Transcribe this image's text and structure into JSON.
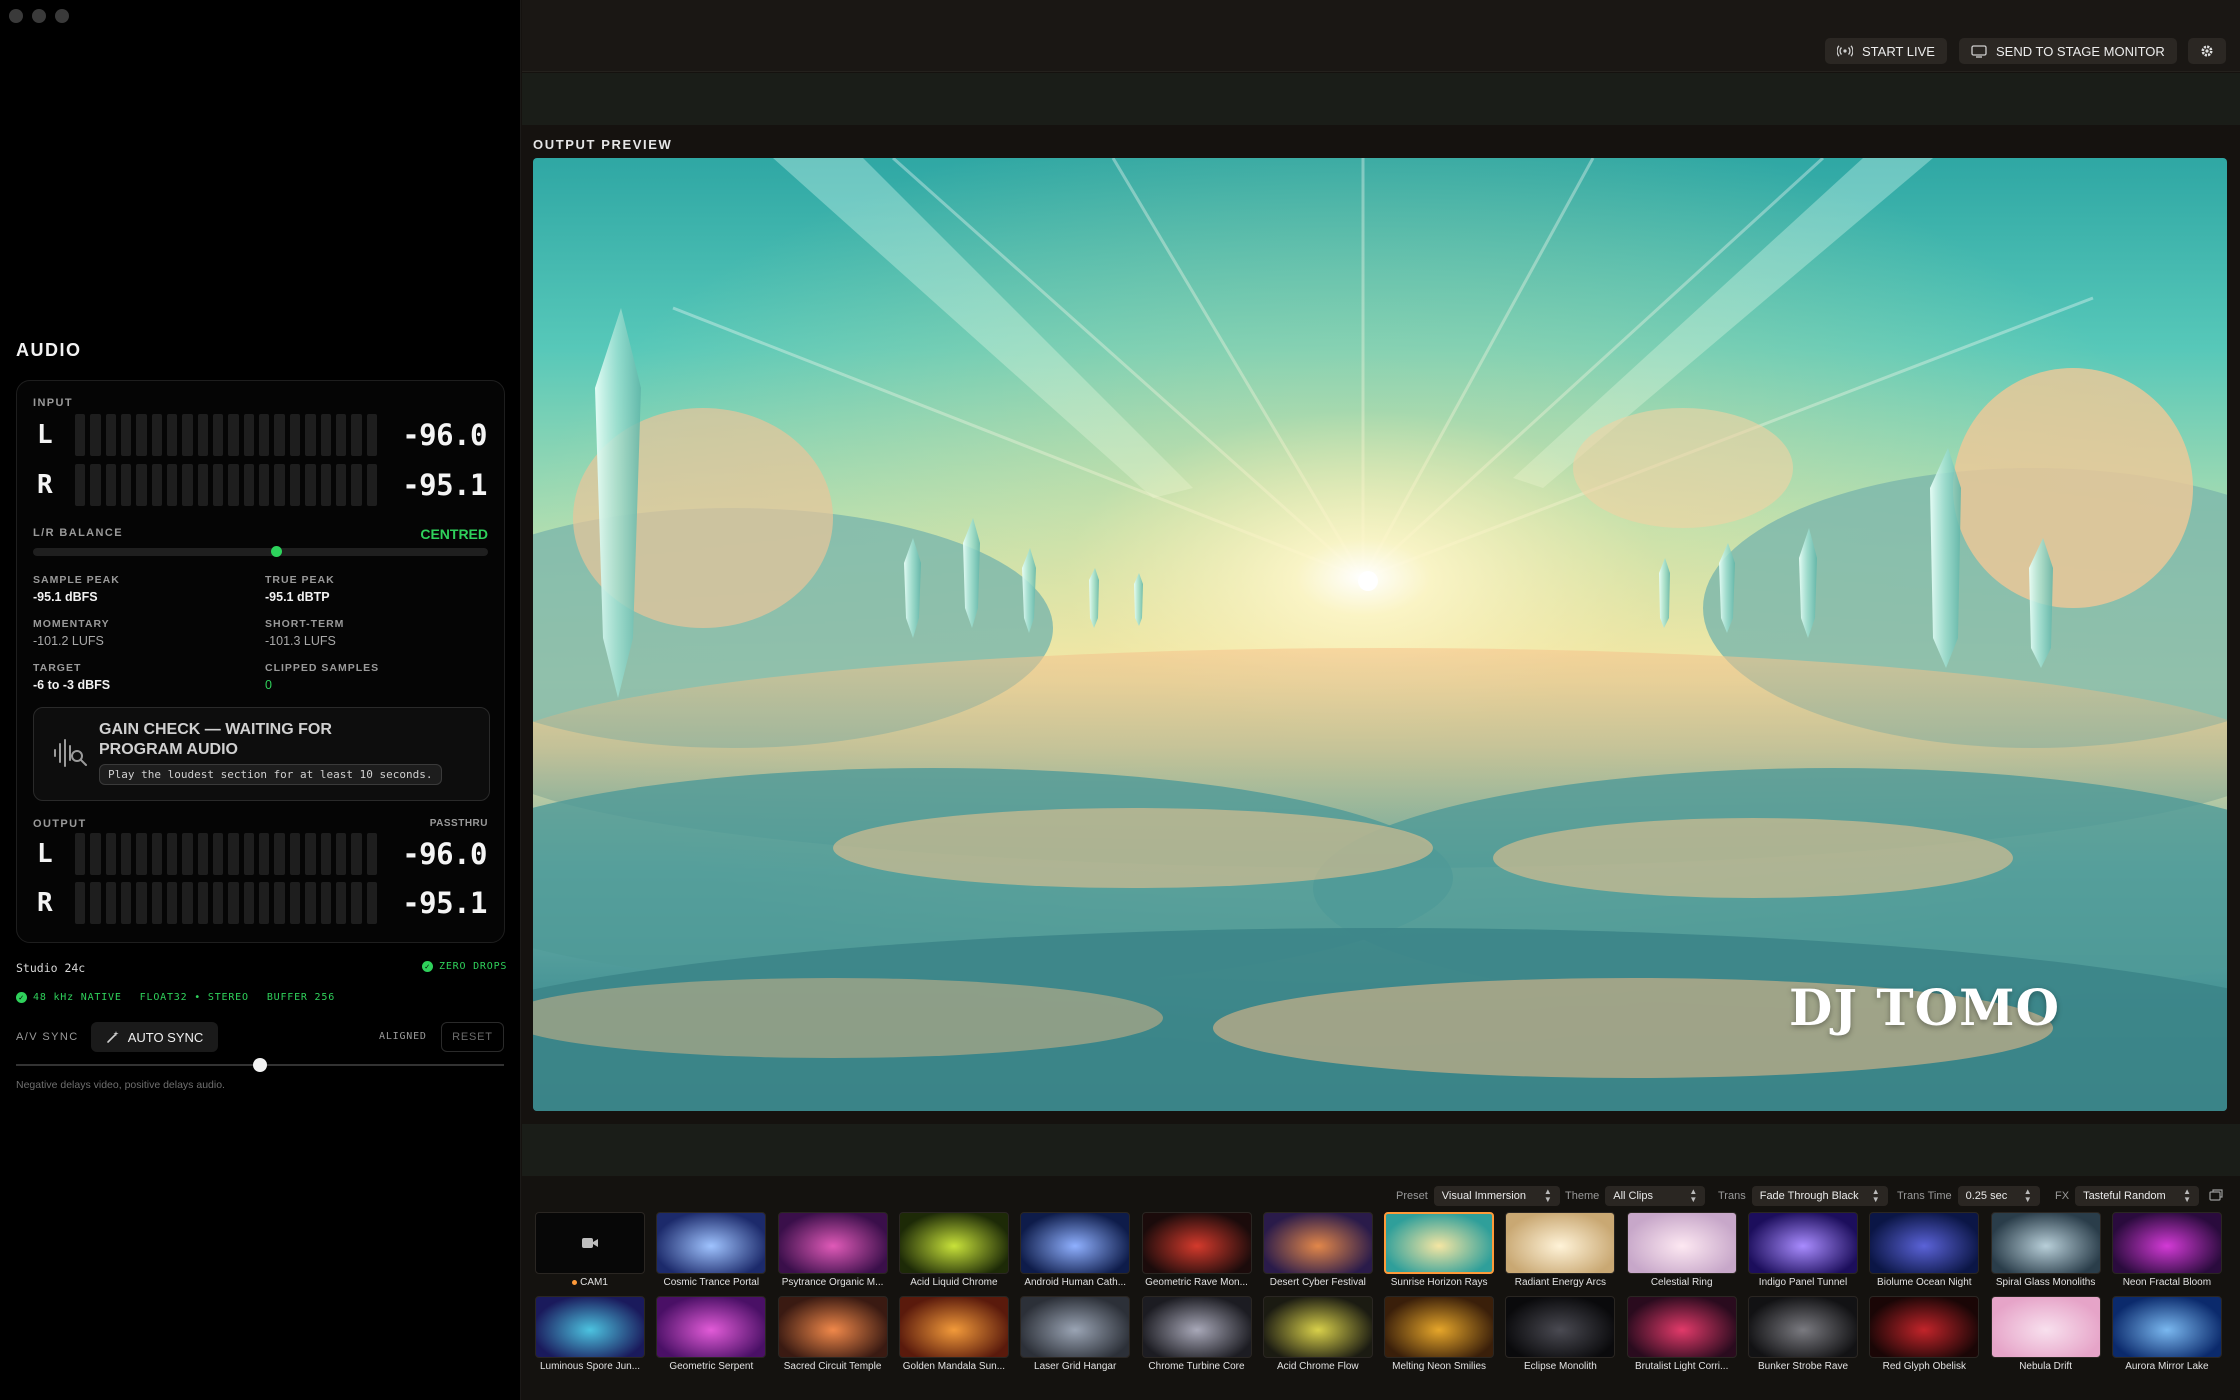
{
  "sidebar": {
    "title": "AUDIO",
    "input": {
      "label": "INPUT",
      "left": {
        "ch": "L",
        "value": "-96.0"
      },
      "right": {
        "ch": "R",
        "value": "-95.1"
      }
    },
    "balance": {
      "label": "L/R BALANCE",
      "status": "CENTRED",
      "position": 0.5
    },
    "stats": {
      "sample_peak": {
        "k": "SAMPLE PEAK",
        "v": "-95.1 dBFS"
      },
      "true_peak": {
        "k": "TRUE PEAK",
        "v": "-95.1 dBTP"
      },
      "momentary": {
        "k": "MOMENTARY",
        "v": "-101.2 LUFS"
      },
      "short_term": {
        "k": "SHORT-TERM",
        "v": "-101.3 LUFS"
      },
      "target": {
        "k": "TARGET",
        "v": "-6 to -3 dBFS"
      },
      "clipped": {
        "k": "CLIPPED SAMPLES",
        "v": "0"
      }
    },
    "gain_check": {
      "title": "GAIN CHECK — WAITING FOR PROGRAM AUDIO",
      "hint": "Play the loudest section for at least 10 seconds."
    },
    "output": {
      "label": "OUTPUT",
      "mode": "PASSTHRU",
      "left": {
        "ch": "L",
        "value": "-96.0"
      },
      "right": {
        "ch": "R",
        "value": "-95.1"
      }
    },
    "device": {
      "name": "Studio 24c",
      "drops": "ZERO DROPS",
      "rate": "48 kHz NATIVE",
      "format": "FLOAT32 • STEREO",
      "buffer": "BUFFER 256"
    },
    "av_sync": {
      "label": "A/V SYNC",
      "auto": "AUTO SYNC",
      "status": "ALIGNED",
      "reset": "RESET",
      "hint": "Negative delays video, positive delays audio.",
      "slider": 0.5
    }
  },
  "toolbar": {
    "start_live": "START LIVE",
    "stage_monitor": "SEND TO STAGE MONITOR"
  },
  "preview": {
    "label": "OUTPUT PREVIEW",
    "overlay_text": "DJ TOMO"
  },
  "controls": {
    "preset": {
      "label": "Preset",
      "value": "Visual Immersion"
    },
    "theme": {
      "label": "Theme",
      "value": "All Clips"
    },
    "trans": {
      "label": "Trans",
      "value": "Fade Through Black"
    },
    "trans_time": {
      "label": "Trans Time",
      "value": "0.25 sec"
    },
    "fx": {
      "label": "FX",
      "value": "Tasteful Random"
    }
  },
  "clips_row1": [
    {
      "name": "CAM1",
      "cam": true
    },
    {
      "name": "Cosmic Trance Portal",
      "c1": "#1c2a6b",
      "c2": "#9fc3ff"
    },
    {
      "name": "Psytrance Organic M...",
      "c1": "#3a0f4a",
      "c2": "#e05ab8"
    },
    {
      "name": "Acid Liquid Chrome",
      "c1": "#1d2a07",
      "c2": "#c8e23a"
    },
    {
      "name": "Android Human Cath...",
      "c1": "#0e1c4a",
      "c2": "#8fb0ff"
    },
    {
      "name": "Geometric Rave Mon...",
      "c1": "#1b0b0b",
      "c2": "#d43a2c"
    },
    {
      "name": "Desert Cyber Festival",
      "c1": "#2a1b4a",
      "c2": "#e2874a"
    },
    {
      "name": "Sunrise Horizon Rays",
      "c1": "#2f9f9a",
      "c2": "#f5e6a3",
      "active": true
    },
    {
      "name": "Radiant Energy Arcs",
      "c1": "#c9a873",
      "c2": "#fff3d8"
    },
    {
      "name": "Celestial Ring",
      "c1": "#c7a7c9",
      "c2": "#fde8f2"
    },
    {
      "name": "Indigo Panel Tunnel",
      "c1": "#1c0e5c",
      "c2": "#a98cff"
    },
    {
      "name": "Biolume Ocean Night",
      "c1": "#0b1646",
      "c2": "#5b63d8"
    },
    {
      "name": "Spiral Glass Monoliths",
      "c1": "#2a3d4a",
      "c2": "#b8cfd9"
    },
    {
      "name": "Neon Fractal Bloom",
      "c1": "#2a0b3d",
      "c2": "#d33ad6"
    }
  ],
  "clips_row2": [
    {
      "name": "Luminous Spore Jun...",
      "c1": "#1a1a5c",
      "c2": "#4cc3e0"
    },
    {
      "name": "Geometric Serpent",
      "c1": "#4a1066",
      "c2": "#e25bd8"
    },
    {
      "name": "Sacred Circuit Temple",
      "c1": "#3a1a12",
      "c2": "#f0884a"
    },
    {
      "name": "Golden Mandala Sun...",
      "c1": "#5a1a0c",
      "c2": "#f29a3a"
    },
    {
      "name": "Laser Grid Hangar",
      "c1": "#2c3038",
      "c2": "#9aa4b4"
    },
    {
      "name": "Chrome Turbine Core",
      "c1": "#1c1c22",
      "c2": "#a8a8b8"
    },
    {
      "name": "Acid Chrome Flow",
      "c1": "#1b1b12",
      "c2": "#d8d04a"
    },
    {
      "name": "Melting Neon Smilies",
      "c1": "#3a1f0a",
      "c2": "#e6a62a"
    },
    {
      "name": "Eclipse Monolith",
      "c1": "#0a0a0c",
      "c2": "#4a4a52"
    },
    {
      "name": "Brutalist Light Corri...",
      "c1": "#2a0b1e",
      "c2": "#e23a6a"
    },
    {
      "name": "Bunker Strobe Rave",
      "c1": "#121214",
      "c2": "#7a7a80"
    },
    {
      "name": "Red Glyph Obelisk",
      "c1": "#1a0606",
      "c2": "#c2242a"
    },
    {
      "name": "Nebula Drift",
      "c1": "#e6a4c8",
      "c2": "#f8e0ee"
    },
    {
      "name": "Aurora Mirror Lake",
      "c1": "#0b2a6c",
      "c2": "#7ab8f0"
    }
  ]
}
